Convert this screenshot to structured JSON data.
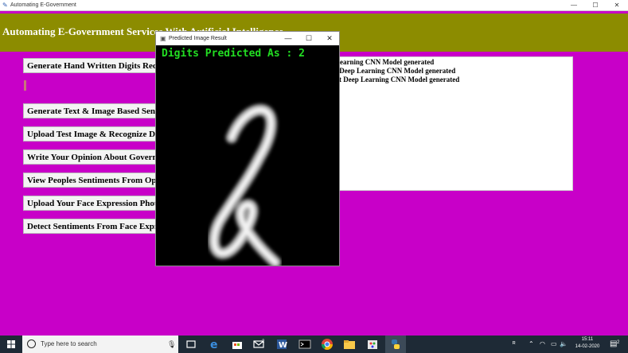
{
  "window": {
    "title": "Automating E-Government",
    "minimize_glyph": "—",
    "maximize_glyph": "☐",
    "close_glyph": "✕"
  },
  "header": {
    "title": "Automating E-Government Services With Artificial Intelligence"
  },
  "buttons": [
    "Generate Hand Written Digits Recognition Deep Learning Model",
    "Generate Text & Image Based Sentiment Detection Deep Learning Model",
    "Upload Test Image & Recognize Digit",
    "Write Your Opinion About Government Policies",
    "View Peoples Sentiments From Opinions",
    "Upload Your Face Expression Photo About Government Policies",
    "Detect Sentiments From Face Expression Photo"
  ],
  "output": {
    "lines": [
      "Learning CNN Model generated",
      "t Deep Learning CNN Model generated",
      "nt Deep Learning CNN Model generated"
    ]
  },
  "popup": {
    "title": "Predicted Image Result",
    "prediction_text": "Digits Predicted As : 2",
    "minimize_glyph": "—",
    "maximize_glyph": "☐",
    "close_glyph": "✕"
  },
  "taskbar": {
    "search_placeholder": "Type here to search",
    "time": "15:11",
    "date": "14-02-2020",
    "mail_badge": "2",
    "notification_count": "2",
    "icons": [
      "task-view-icon",
      "edge-icon",
      "store-icon",
      "mail-icon",
      "word-icon",
      "terminal-icon",
      "chrome-icon",
      "file-explorer-icon",
      "paint-icon",
      "python-icon"
    ]
  },
  "colors": {
    "background": "#c800c8",
    "header": "#8c8c00",
    "prediction": "#22dd22",
    "taskbar": "#1e2a36"
  }
}
